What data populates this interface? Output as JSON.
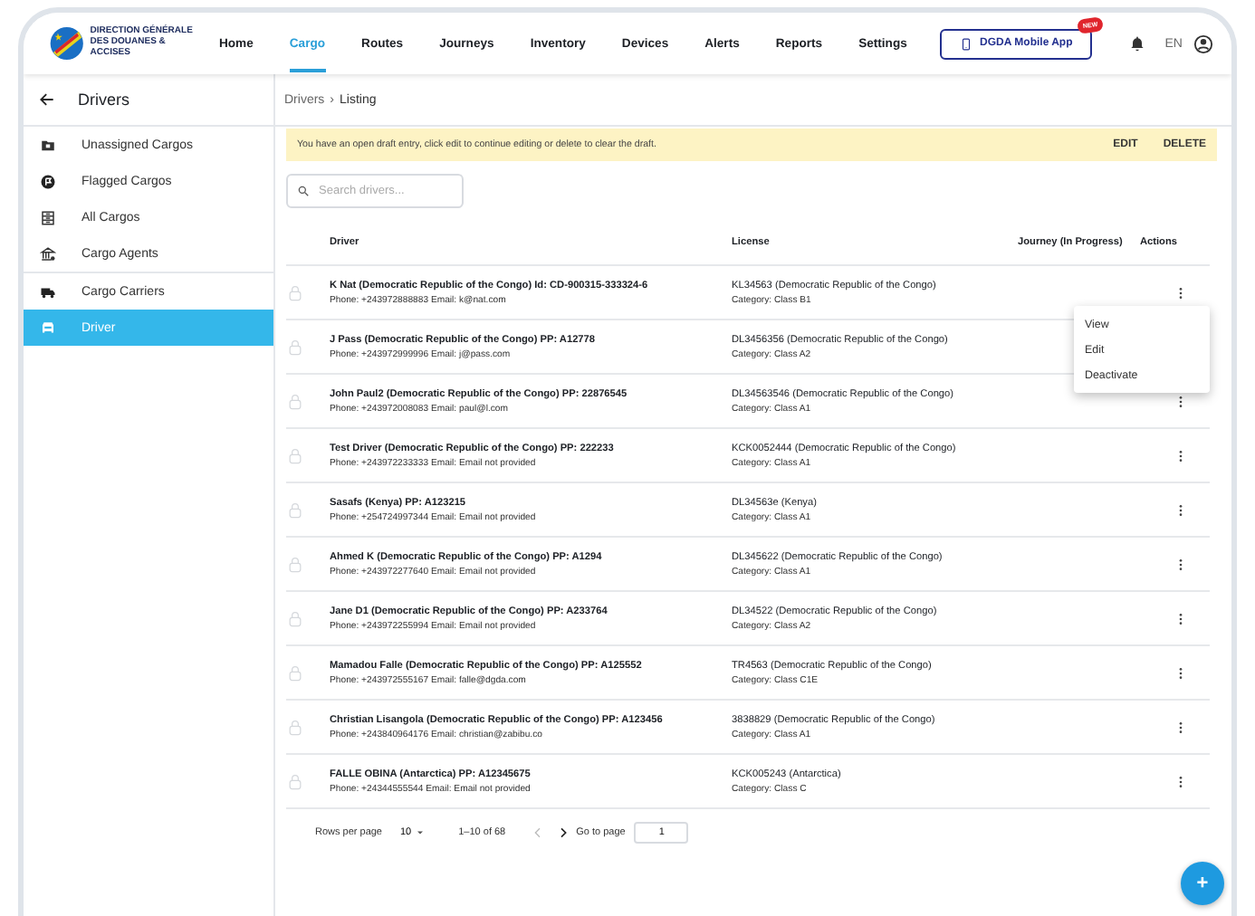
{
  "nav": {
    "logo_text": "DIRECTION GÉNÉRALE DES DOUANES & ACCISES",
    "items": [
      {
        "label": "Home",
        "selected": false
      },
      {
        "label": "Cargo",
        "selected": true
      },
      {
        "label": "Routes",
        "selected": false
      },
      {
        "label": "Journeys",
        "selected": false
      },
      {
        "label": "Inventory",
        "selected": false
      },
      {
        "label": "Devices",
        "selected": false
      },
      {
        "label": "Alerts",
        "selected": false
      },
      {
        "label": "Reports",
        "selected": false
      },
      {
        "label": "Settings",
        "selected": false
      }
    ],
    "app_button": {
      "label": "DGDA Mobile App",
      "badge": "NEW"
    },
    "language": "EN"
  },
  "sidebar": {
    "title": "Drivers",
    "groups": [
      [
        {
          "label": "Unassigned Cargos",
          "selected": false
        },
        {
          "label": "Flagged Cargos",
          "selected": false
        },
        {
          "label": "All Cargos",
          "selected": false
        },
        {
          "label": "Cargo Agents",
          "selected": false
        }
      ],
      [
        {
          "label": "Cargo Carriers",
          "selected": false
        },
        {
          "label": "Driver",
          "selected": true
        }
      ]
    ]
  },
  "breadcrumb": {
    "items": [
      "Drivers",
      "Listing"
    ],
    "separator": "›"
  },
  "banner": {
    "message": "You have an open draft entry, click edit to continue editing or delete to clear the draft.",
    "actions": [
      "EDIT",
      "DELETE"
    ]
  },
  "search": {
    "placeholder": "Search drivers..."
  },
  "table": {
    "columns": [
      "Driver",
      "License",
      "Journey (In Progress)",
      "Actions"
    ],
    "rows": [
      {
        "driver": "K Nat (Democratic Republic of the Congo) Id: CD-900315-333324-6",
        "contact": "Phone: +243972888883 Email: k@nat.com",
        "license": "KL34563 (Democratic Republic of the Congo)",
        "category": "Category: Class B1",
        "menu_open": true
      },
      {
        "driver": "J Pass (Democratic Republic of the Congo) PP: A12778",
        "contact": "Phone: +243972999996 Email: j@pass.com",
        "license": "DL3456356 (Democratic Republic of the Congo)",
        "category": "Category: Class A2",
        "menu_open": false
      },
      {
        "driver": "John Paul2 (Democratic Republic of the Congo) PP: 22876545",
        "contact": "Phone: +243972008083 Email: paul@l.com",
        "license": "DL34563546 (Democratic Republic of the Congo)",
        "category": "Category: Class A1",
        "menu_open": false
      },
      {
        "driver": "Test Driver (Democratic Republic of the Congo) PP: 222233",
        "contact": "Phone: +243972233333 Email: Email not provided",
        "license": "KCK0052444 (Democratic Republic of the Congo)",
        "category": "Category: Class A1",
        "menu_open": false
      },
      {
        "driver": "Sasafs (Kenya) PP: A123215",
        "contact": "Phone: +254724997344 Email: Email not provided",
        "license": "DL34563e (Kenya)",
        "category": "Category: Class A1",
        "menu_open": false
      },
      {
        "driver": "Ahmed K (Democratic Republic of the Congo) PP: A1294",
        "contact": "Phone: +243972277640 Email: Email not provided",
        "license": "DL345622 (Democratic Republic of the Congo)",
        "category": "Category: Class A1",
        "menu_open": false
      },
      {
        "driver": "Jane D1 (Democratic Republic of the Congo) PP: A233764",
        "contact": "Phone: +243972255994 Email: Email not provided",
        "license": "DL34522 (Democratic Republic of the Congo)",
        "category": "Category: Class A2",
        "menu_open": false
      },
      {
        "driver": "Mamadou Falle (Democratic Republic of the Congo) PP: A125552",
        "contact": "Phone: +243972555167 Email: falle@dgda.com",
        "license": "TR4563 (Democratic Republic of the Congo)",
        "category": "Category: Class C1E",
        "menu_open": false
      },
      {
        "driver": "Christian Lisangola (Democratic Republic of the Congo) PP: A123456",
        "contact": "Phone: +243840964176 Email: christian@zabibu.co",
        "license": "3838829 (Democratic Republic of the Congo)",
        "category": "Category: Class A1",
        "menu_open": false
      },
      {
        "driver": "FALLE OBINA (Antarctica) PP: A12345675",
        "contact": "Phone: +24344555544 Email: Email not provided",
        "license": "KCK005243 (Antarctica)",
        "category": "Category: Class C",
        "menu_open": false
      }
    ]
  },
  "row_menu": {
    "items": [
      "View",
      "Edit",
      "Deactivate"
    ]
  },
  "pagination": {
    "rows_per_page_label": "Rows per page",
    "rows_per_page": "10",
    "range": "1–10 of 68",
    "goto_label": "Go to page",
    "page": "1"
  },
  "fab": {
    "label": "+"
  }
}
